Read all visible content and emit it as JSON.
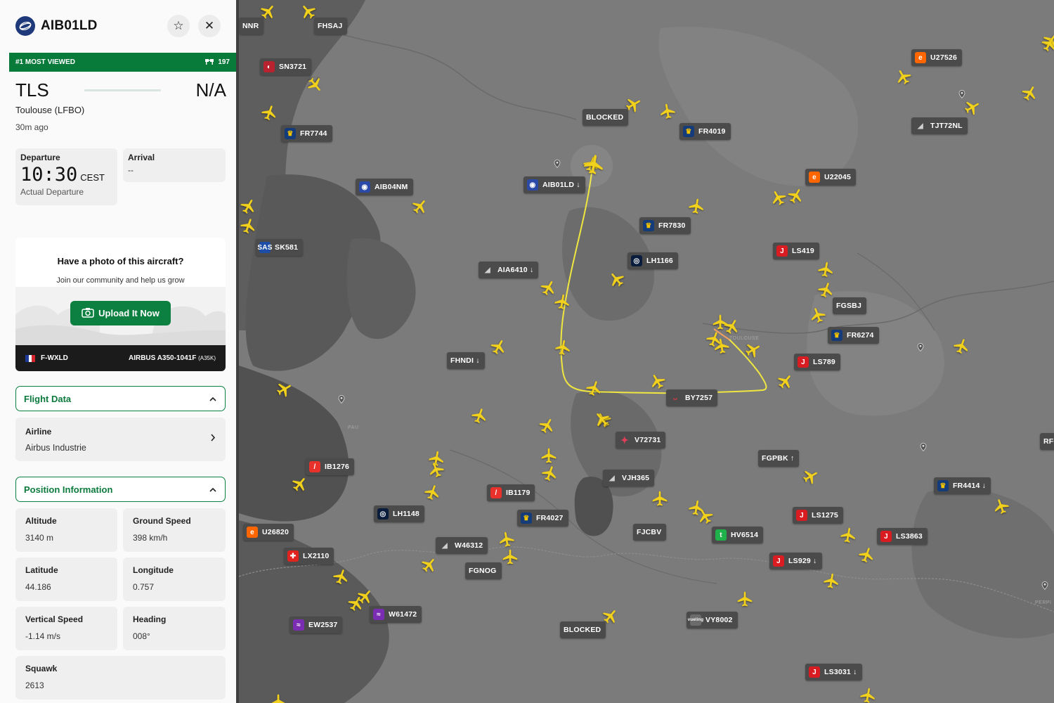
{
  "flight": {
    "callsign": "AIB01LD",
    "rank_label": "#1 MOST VIEWED",
    "viewer_count": "197",
    "origin_code": "TLS",
    "origin_city": "Toulouse (LFBO)",
    "destination_code": "N/A",
    "ago": "30m ago"
  },
  "departure": {
    "label": "Departure",
    "time": "10:30",
    "tz": "CEST",
    "sub": "Actual Departure"
  },
  "arrival": {
    "label": "Arrival",
    "value": "--"
  },
  "photo_prompt": {
    "question": "Have a photo of this aircraft?",
    "subtitle": "Join our community and help us grow",
    "button": "Upload It Now",
    "registration": "F-WXLD",
    "aircraft_type": "AIRBUS A350-1041F",
    "type_code": "(A35K)"
  },
  "sections": {
    "flight_data": "Flight Data",
    "position_information": "Position Information"
  },
  "airline": {
    "label": "Airline",
    "value": "Airbus Industrie"
  },
  "position": {
    "altitude": {
      "label": "Altitude",
      "value": "3140 m"
    },
    "ground_speed": {
      "label": "Ground Speed",
      "value": "398 km/h"
    },
    "latitude": {
      "label": "Latitude",
      "value": "44.186"
    },
    "longitude": {
      "label": "Longitude",
      "value": "0.757"
    },
    "vertical_speed": {
      "label": "Vertical Speed",
      "value": "-1.14 m/s"
    },
    "heading": {
      "label": "Heading",
      "value": "008°"
    },
    "squawk": {
      "label": "Squawk",
      "value": "2613"
    }
  },
  "colors": {
    "brand_green": "#087b3a",
    "aircraft_yellow": "#f2d11c",
    "map_gray": "#757575",
    "label_bg": "#4b4b4b"
  },
  "map_text": {
    "toulouse": "TOULOUSE",
    "pau": "PAU",
    "perpignan": "PERPI"
  },
  "map_labels": [
    {
      "id": "NNR",
      "text": "NNR",
      "logo": "none"
    },
    {
      "id": "FHSAJ",
      "text": "FHSAJ",
      "logo": "none"
    },
    {
      "id": "SN3721",
      "text": "SN3721",
      "logo": "sn"
    },
    {
      "id": "FR7744",
      "text": "FR7744",
      "logo": "ry"
    },
    {
      "id": "BLOCKED1",
      "text": "BLOCKED",
      "logo": "none"
    },
    {
      "id": "FR4019",
      "text": "FR4019",
      "logo": "ry"
    },
    {
      "id": "U27526",
      "text": "U27526",
      "logo": "ez"
    },
    {
      "id": "TJT72NL",
      "text": "TJT72NL",
      "logo": "gy"
    },
    {
      "id": "AIB04NM",
      "text": "AIB04NM",
      "logo": "ai"
    },
    {
      "id": "AIB01LD",
      "text": "AIB01LD ↓",
      "logo": "ai"
    },
    {
      "id": "U22045",
      "text": "U22045",
      "logo": "ez"
    },
    {
      "id": "FR7830",
      "text": "FR7830",
      "logo": "ry"
    },
    {
      "id": "SK581",
      "text": "SK581",
      "logo": "sk"
    },
    {
      "id": "LS419",
      "text": "LS419",
      "logo": "vl"
    },
    {
      "id": "LH1166",
      "text": "LH1166",
      "logo": "lh"
    },
    {
      "id": "AIA6410",
      "text": "AIA6410 ↓",
      "logo": "gy"
    },
    {
      "id": "FGSBJ",
      "text": "FGSBJ",
      "logo": "none"
    },
    {
      "id": "FR6274",
      "text": "FR6274",
      "logo": "ry"
    },
    {
      "id": "FHNDI",
      "text": "FHNDI ↓",
      "logo": "none"
    },
    {
      "id": "LS789",
      "text": "LS789",
      "logo": "vl"
    },
    {
      "id": "BY7257",
      "text": "BY7257",
      "logo": "bv"
    },
    {
      "id": "V72731",
      "text": "V72731",
      "logo": "v7"
    },
    {
      "id": "FGPBK",
      "text": "FGPBK ↑",
      "logo": "none"
    },
    {
      "id": "IB1276",
      "text": "IB1276",
      "logo": "ib"
    },
    {
      "id": "VJH365",
      "text": "VJH365",
      "logo": "gy"
    },
    {
      "id": "FR4414",
      "text": "FR4414 ↓",
      "logo": "ry"
    },
    {
      "id": "IB1179",
      "text": "IB1179",
      "logo": "ib"
    },
    {
      "id": "LH1148",
      "text": "LH1148",
      "logo": "lh"
    },
    {
      "id": "FR4027",
      "text": "FR4027",
      "logo": "ry"
    },
    {
      "id": "FJCBV",
      "text": "FJCBV",
      "logo": "none"
    },
    {
      "id": "LS1275",
      "text": "LS1275",
      "logo": "vl"
    },
    {
      "id": "HV6514",
      "text": "HV6514",
      "logo": "tr"
    },
    {
      "id": "LS3863",
      "text": "LS3863",
      "logo": "vl"
    },
    {
      "id": "U26820",
      "text": "U26820",
      "logo": "ez"
    },
    {
      "id": "W46312",
      "text": "W46312",
      "logo": "gy"
    },
    {
      "id": "LX2110",
      "text": "LX2110",
      "logo": "sw"
    },
    {
      "id": "FGNOG",
      "text": "FGNOG",
      "logo": "none"
    },
    {
      "id": "LS929",
      "text": "LS929 ↓",
      "logo": "vl"
    },
    {
      "id": "W61472",
      "text": "W61472",
      "logo": "ew"
    },
    {
      "id": "EW2537",
      "text": "EW2537",
      "logo": "ew"
    },
    {
      "id": "BLOCKED2",
      "text": "BLOCKED",
      "logo": "none"
    },
    {
      "id": "VY8002",
      "text": "VY8002",
      "logo": "vg"
    },
    {
      "id": "LS3031",
      "text": "LS3031 ↓",
      "logo": "vl"
    },
    {
      "id": "RFC",
      "text": "RFC",
      "logo": "none"
    }
  ]
}
